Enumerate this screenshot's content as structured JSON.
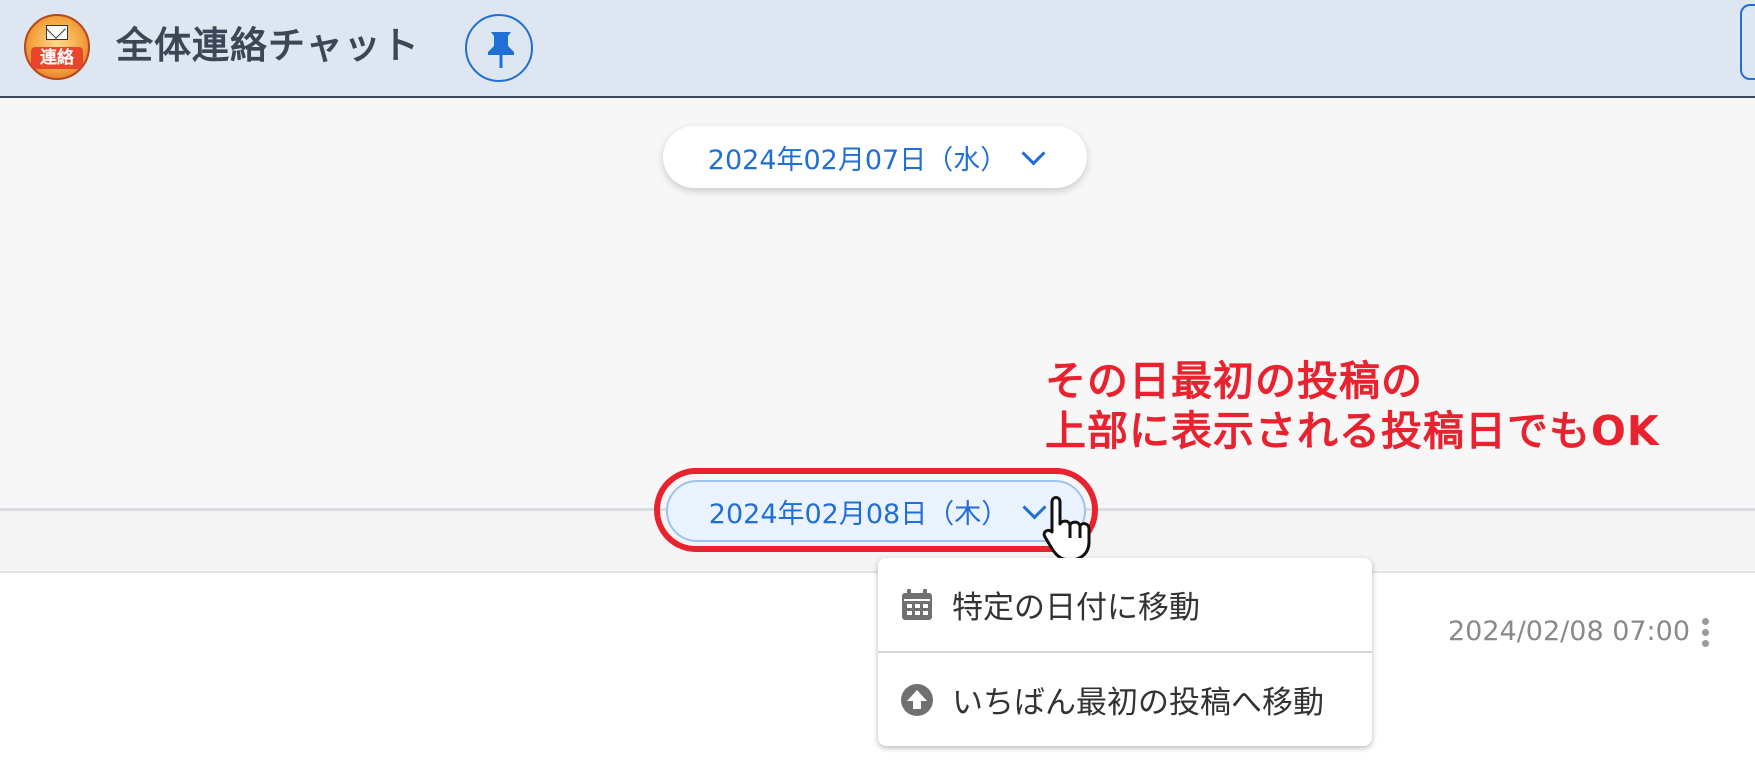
{
  "header": {
    "logo_text": "連絡",
    "title": "全体連絡チャット",
    "pin_icon": "pin-icon"
  },
  "date_separators": [
    {
      "label": "2024年02月07日（水）"
    },
    {
      "label": "2024年02月08日（木）"
    }
  ],
  "annotation": {
    "line1": "その日最初の投稿の",
    "line2": "上部に表示される投稿日でもOK",
    "color": "#e8232f"
  },
  "menu": {
    "items": [
      {
        "label": "特定の日付に移動",
        "icon": "calendar-icon"
      },
      {
        "label": "いちばん最初の投稿へ移動",
        "icon": "arrow-up-circle-icon"
      }
    ]
  },
  "post": {
    "timestamp": "2024/02/08 07:00"
  },
  "colors": {
    "accent": "#1f6fd6",
    "header_bg": "#dde6f1",
    "highlight": "#e8232f"
  }
}
